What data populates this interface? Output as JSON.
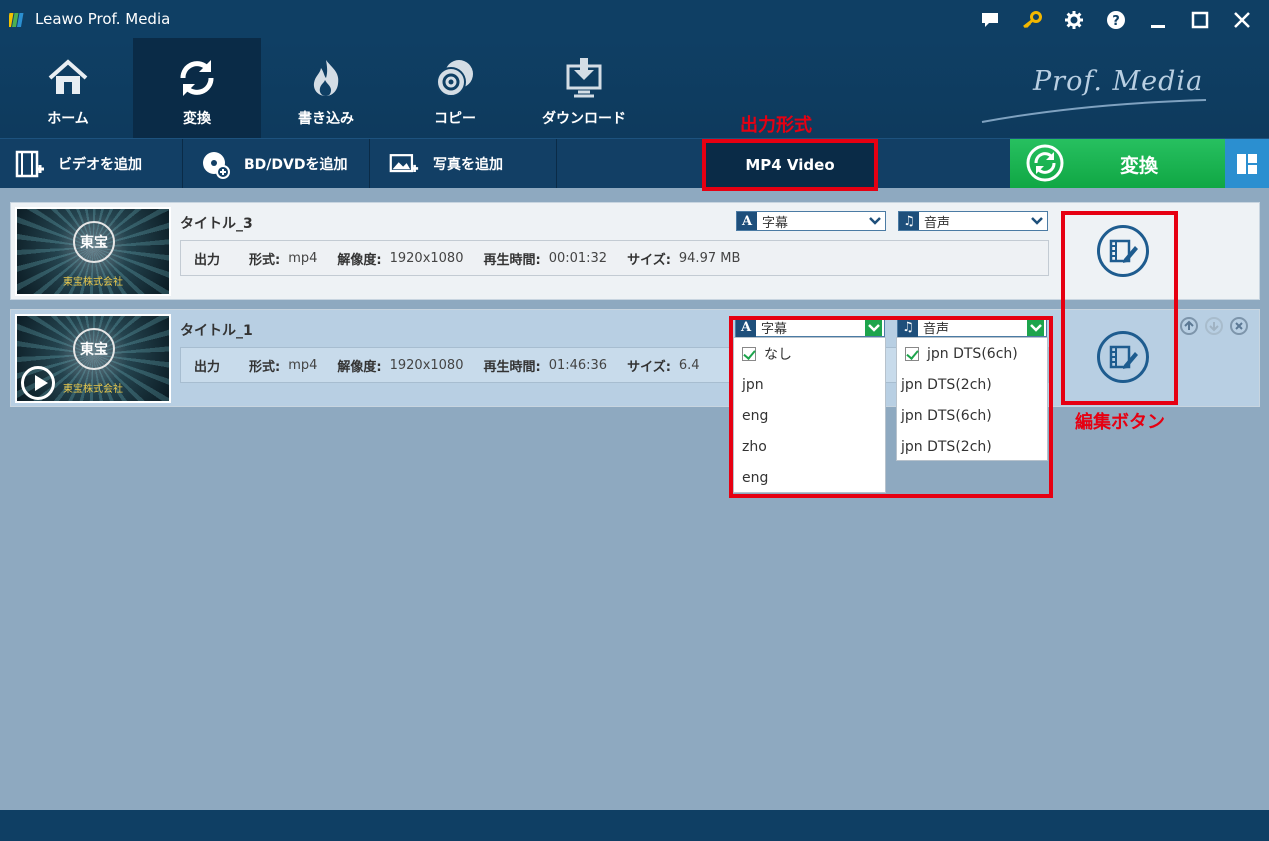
{
  "app": {
    "title": "Leawo Prof. Media",
    "brand": "Prof. Media"
  },
  "nav": {
    "home": "ホーム",
    "convert": "変換",
    "burn": "書き込み",
    "copy": "コピー",
    "download": "ダウンロード"
  },
  "toolbar": {
    "add_video": "ビデオを追加",
    "add_bddvd": "BD/DVDを追加",
    "add_photo": "写真を追加",
    "format": "MP4 Video",
    "convert": "変換"
  },
  "annotations": {
    "output_format": "出力形式",
    "edit_button": "編集ボタン"
  },
  "labels": {
    "output": "出力",
    "format": "形式:",
    "resolution": "解像度:",
    "duration": "再生時間:",
    "size": "サイズ:",
    "subtitle": "字幕",
    "audio": "音声"
  },
  "rows": [
    {
      "title": "タイトル_3",
      "format": "mp4",
      "resolution": "1920x1080",
      "duration": "00:01:32",
      "size": "94.97 MB"
    },
    {
      "title": "タイトル_1",
      "format": "mp4",
      "resolution": "1920x1080",
      "duration": "01:46:36",
      "size": "6.4"
    }
  ],
  "thumbnail": {
    "seal": "東宝",
    "company": "東宝株式会社"
  },
  "subtitle_options": [
    {
      "label": "なし",
      "checked": true
    },
    {
      "label": "jpn",
      "checked": false
    },
    {
      "label": "eng",
      "checked": false
    },
    {
      "label": "zho",
      "checked": false
    },
    {
      "label": "eng",
      "checked": false
    }
  ],
  "audio_options": [
    {
      "label": "jpn DTS(6ch)",
      "checked": true
    },
    {
      "label": "jpn DTS(2ch)",
      "checked": false
    },
    {
      "label": "jpn DTS(6ch)",
      "checked": false
    },
    {
      "label": "jpn DTS(2ch)",
      "checked": false
    }
  ],
  "colors": {
    "titlebar": "#0f3f64",
    "accent_green": "#10a744",
    "annotation_red": "#e60012",
    "workspace": "#8ea9c0"
  },
  "icons": [
    "app-logo-icon",
    "feedback-icon",
    "key-icon",
    "gear-icon",
    "help-icon",
    "minimize-icon",
    "maximize-icon",
    "close-icon",
    "home-icon",
    "convert-icon",
    "burn-icon",
    "copy-icon",
    "download-icon",
    "add-video-icon",
    "add-disc-icon",
    "add-photo-icon",
    "refresh-icon",
    "layout-icon",
    "edit-icon",
    "move-up-icon",
    "move-down-icon",
    "remove-icon",
    "play-icon"
  ]
}
